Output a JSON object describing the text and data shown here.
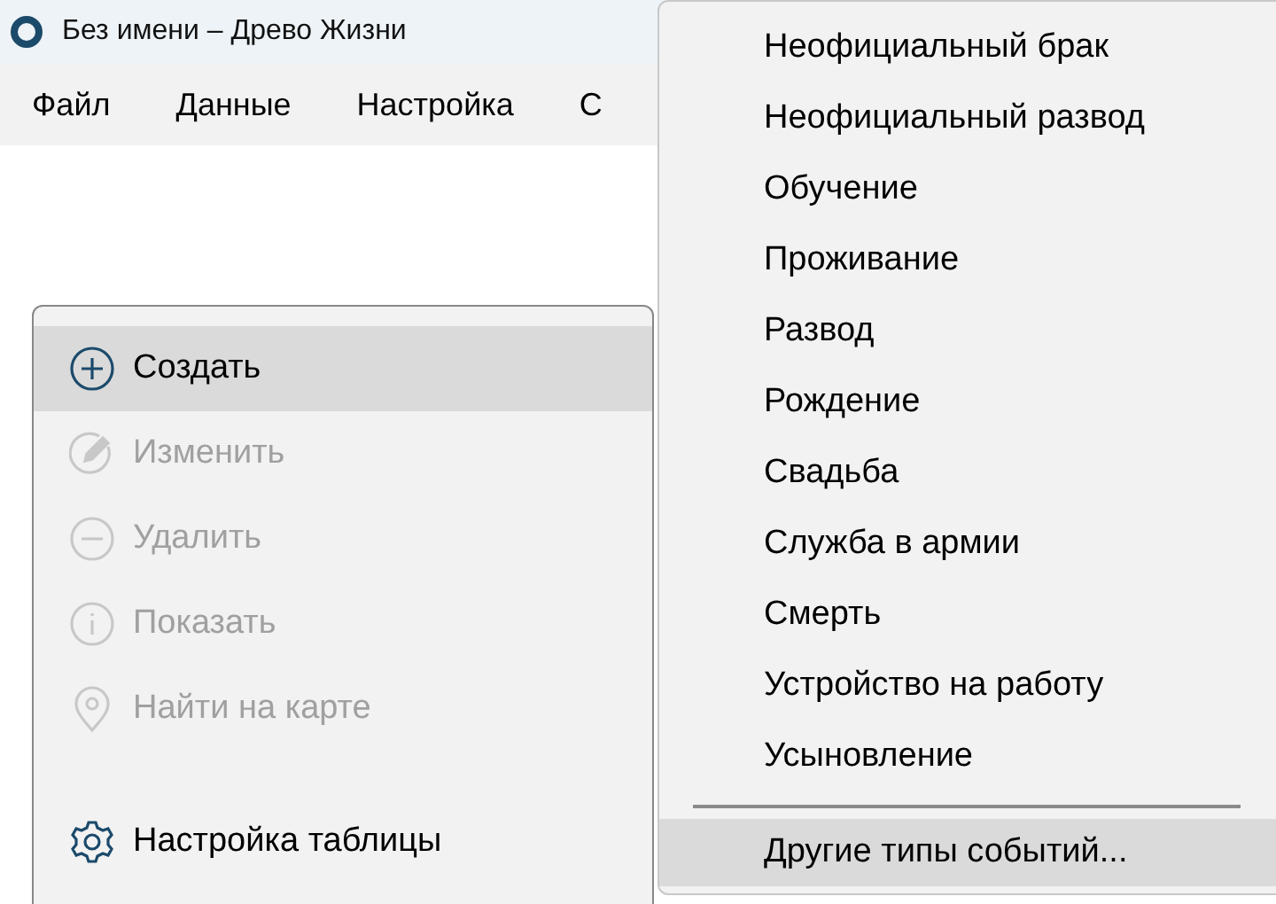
{
  "window": {
    "title": "Без имени – Древо Жизни"
  },
  "menu_bar": [
    "Файл",
    "Данные",
    "Настройка",
    "С"
  ],
  "context_menu": {
    "items": [
      {
        "label": "Создать",
        "kind": "plus",
        "disabled": false,
        "selected": true
      },
      {
        "label": "Изменить",
        "kind": "pencil",
        "disabled": true,
        "selected": false
      },
      {
        "label": "Удалить",
        "kind": "minus",
        "disabled": true,
        "selected": false
      },
      {
        "label": "Показать",
        "kind": "info",
        "disabled": true,
        "selected": false
      },
      {
        "label": "Найти на карте",
        "kind": "pin",
        "disabled": true,
        "selected": false
      },
      {
        "label": "Настройка таблицы",
        "kind": "gear",
        "disabled": false,
        "selected": false,
        "separated": true
      }
    ]
  },
  "submenu": {
    "items": [
      {
        "label": "Неофициальный брак",
        "selected": false
      },
      {
        "label": "Неофициальный развод",
        "selected": false
      },
      {
        "label": "Обучение",
        "selected": false
      },
      {
        "label": "Проживание",
        "selected": false
      },
      {
        "label": "Развод",
        "selected": false
      },
      {
        "label": "Рождение",
        "selected": false
      },
      {
        "label": "Свадьба",
        "selected": false
      },
      {
        "label": "Служба в армии",
        "selected": false
      },
      {
        "label": "Смерть",
        "selected": false
      },
      {
        "label": "Устройство на работу",
        "selected": false
      },
      {
        "label": "Усыновление",
        "selected": false
      },
      {
        "label": "Другие типы событий...",
        "selected": true,
        "separated": true
      }
    ]
  }
}
